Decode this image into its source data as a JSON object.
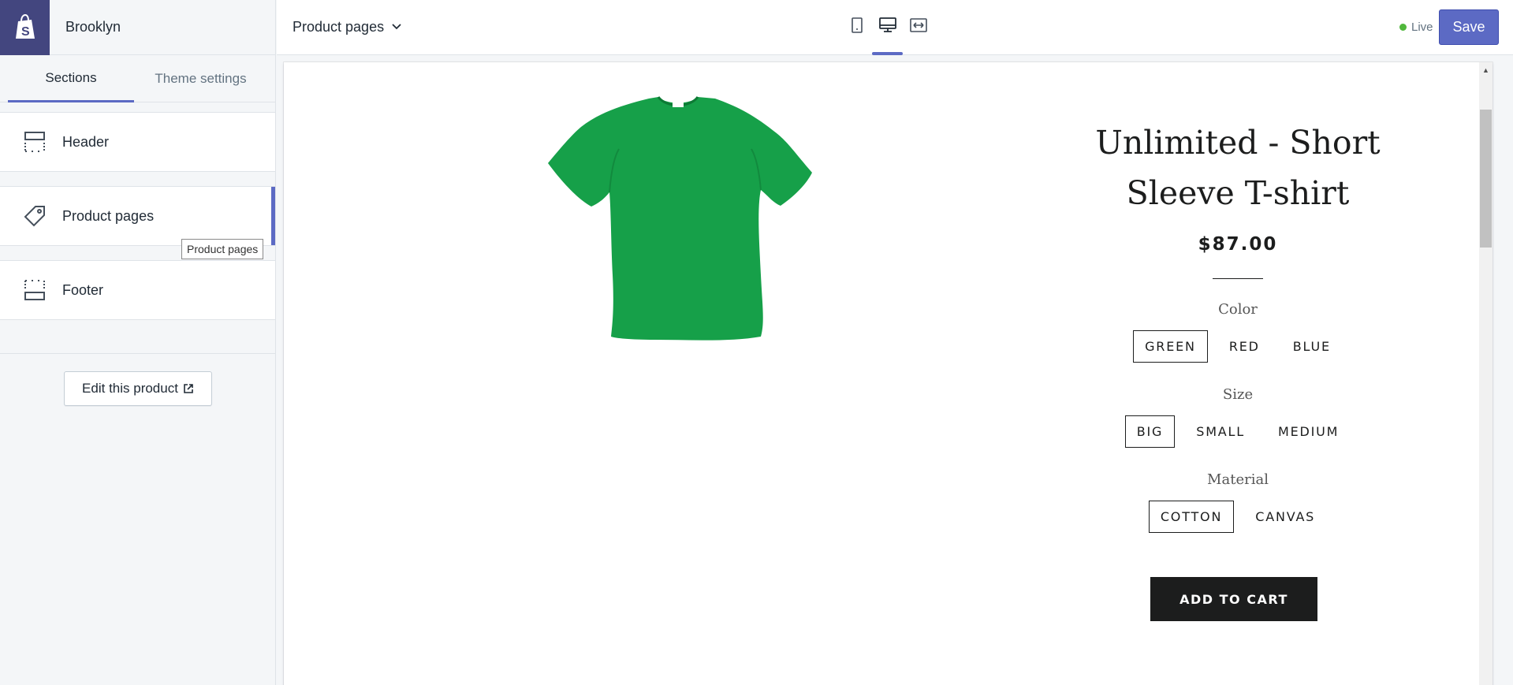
{
  "app": {
    "store_name": "Brooklyn"
  },
  "sidebar": {
    "tabs": [
      {
        "label": "Sections",
        "active": true
      },
      {
        "label": "Theme settings",
        "active": false
      }
    ],
    "sections": [
      {
        "label": "Header",
        "icon": "header-layout-icon"
      },
      {
        "label": "Product pages",
        "icon": "tag-icon",
        "active": true
      },
      {
        "label": "Footer",
        "icon": "footer-layout-icon"
      }
    ],
    "tooltip": "Product pages",
    "edit_product_label": "Edit this product"
  },
  "topbar": {
    "page_selector": "Product pages",
    "device_buttons": [
      "mobile-icon",
      "desktop-icon",
      "full-width-icon"
    ],
    "active_device": "desktop-icon",
    "status": "Live",
    "save_label": "Save"
  },
  "product": {
    "image": "green-tshirt",
    "title_line1": "Unlimited - Short",
    "title_line2": "Sleeve T-shirt",
    "price": "$87.00",
    "options": [
      {
        "label": "Color",
        "values": [
          "GREEN",
          "RED",
          "BLUE"
        ],
        "selected": "GREEN"
      },
      {
        "label": "Size",
        "values": [
          "BIG",
          "SMALL",
          "MEDIUM"
        ],
        "selected": "BIG"
      },
      {
        "label": "Material",
        "values": [
          "COTTON",
          "CANVAS"
        ],
        "selected": "COTTON"
      }
    ],
    "add_to_cart_label": "ADD TO CART"
  },
  "colors": {
    "accent": "#5c6ac4",
    "logo_bg": "#43467f",
    "live_dot": "#50b83c",
    "tshirt": "#16a049",
    "cart_button": "#1c1d1d"
  }
}
